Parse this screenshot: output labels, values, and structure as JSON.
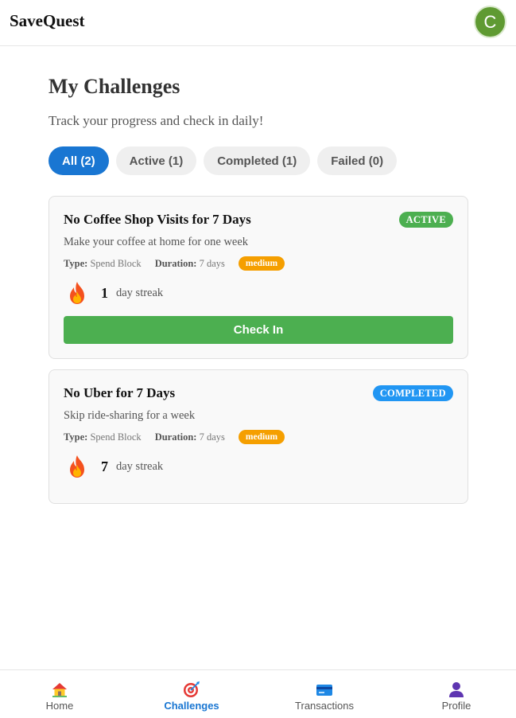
{
  "header": {
    "app_title": "SaveQuest",
    "avatar_initial": "C",
    "avatar_color": "#5f9a32"
  },
  "page": {
    "title": "My Challenges",
    "subtitle": "Track your progress and check in daily!"
  },
  "tabs": [
    {
      "label": "All (2)",
      "selected": true
    },
    {
      "label": "Active (1)"
    },
    {
      "label": "Completed (1)"
    },
    {
      "label": "Failed (0)"
    }
  ],
  "challenges": [
    {
      "title": "No Coffee Shop Visits for 7 Days",
      "status": "ACTIVE",
      "status_color": "#4caf50",
      "description": "Make your coffee at home for one week",
      "type_label": "Type:",
      "type_value": "Spend Block",
      "duration_label": "Duration:",
      "duration_value": "7 days",
      "difficulty": "medium",
      "streak_count": "1",
      "streak_label": "day streak",
      "action_label": "Check In"
    },
    {
      "title": "No Uber for 7 Days",
      "status": "COMPLETED",
      "status_color": "#2196f3",
      "description": "Skip ride-sharing for a week",
      "type_label": "Type:",
      "type_value": "Spend Block",
      "duration_label": "Duration:",
      "duration_value": "7 days",
      "difficulty": "medium",
      "streak_count": "7",
      "streak_label": "day streak"
    }
  ],
  "bottom_nav": [
    {
      "label": "Home",
      "icon": "house-icon"
    },
    {
      "label": "Challenges",
      "icon": "target-icon",
      "selected": true
    },
    {
      "label": "Transactions",
      "icon": "credit-card-icon"
    },
    {
      "label": "Profile",
      "icon": "user-icon"
    }
  ],
  "colors": {
    "accent": "#1976d2",
    "success": "#4caf50",
    "difficulty": "#f59f00",
    "completed": "#2196f3"
  }
}
